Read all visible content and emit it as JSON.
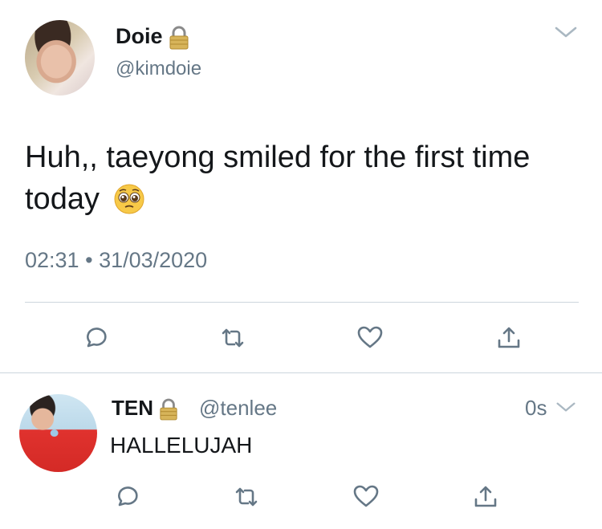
{
  "main_tweet": {
    "display_name": "Doie",
    "handle": "@kimdoie",
    "text": "Huh,, taeyong smiled for the first time today",
    "emoji": "pleading-face",
    "time": "02:31",
    "separator": "•",
    "date": "31/03/2020",
    "icons": [
      "lock-icon",
      "chevron-down-icon",
      "reply-icon",
      "retweet-icon",
      "like-icon",
      "share-icon"
    ]
  },
  "reply_tweet": {
    "display_name": "TEN",
    "handle": "@tenlee",
    "time": "0s",
    "text": "HALLELUJAH",
    "icons": [
      "lock-icon",
      "chevron-down-icon",
      "reply-icon",
      "retweet-icon",
      "like-icon",
      "share-icon"
    ]
  },
  "colors": {
    "text": "#14171a",
    "secondary": "#657786",
    "divider": "#ccd6dd",
    "chevron": "#aab8c2",
    "lock": "#c9a24a"
  }
}
